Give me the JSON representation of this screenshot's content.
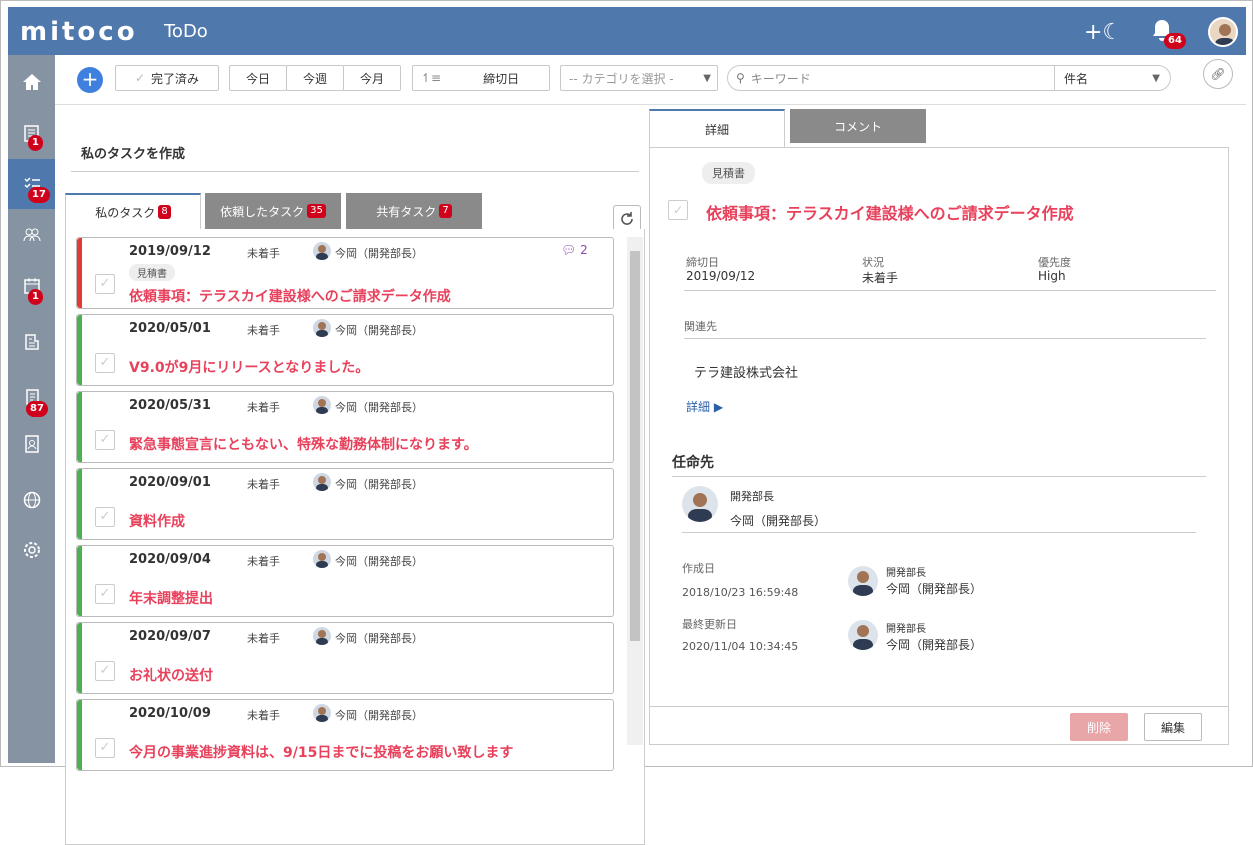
{
  "header": {
    "logo": "mitoco",
    "app_name": "ToDo",
    "quick_add": "+☾",
    "notifications_count": "64"
  },
  "nav": {
    "badges": {
      "doc": "1",
      "todo": "17",
      "calendar": "1",
      "workflow": "87"
    }
  },
  "toolbar": {
    "completed_label": "完了済み",
    "today": "今日",
    "this_week": "今週",
    "this_month": "今月",
    "sort_label": "締切日",
    "category_placeholder": "-- カテゴリを選択 -",
    "keyword_placeholder": "キーワード",
    "search_field": "件名"
  },
  "left": {
    "create_title": "私のタスクを作成",
    "tabs": [
      {
        "label": "私のタスク",
        "count": "8"
      },
      {
        "label": "依頼したタスク",
        "count": "35"
      },
      {
        "label": "共有タスク",
        "count": "7"
      }
    ],
    "tasks": [
      {
        "date": "2019/09/12",
        "status": "未着手",
        "owner": "今岡（開発部長）",
        "tag": "見積書",
        "title": "依頼事項：テラスカイ建設様へのご請求データ作成",
        "comments": "2",
        "color": "#e53935"
      },
      {
        "date": "2020/05/01",
        "status": "未着手",
        "owner": "今岡（開発部長）",
        "title": "V9.0が9月にリリースとなりました。",
        "color": "#4caf50"
      },
      {
        "date": "2020/05/31",
        "status": "未着手",
        "owner": "今岡（開発部長）",
        "title": "緊急事態宣言にともない、特殊な勤務体制になります。",
        "color": "#4caf50"
      },
      {
        "date": "2020/09/01",
        "status": "未着手",
        "owner": "今岡（開発部長）",
        "title": "資料作成",
        "color": "#4caf50"
      },
      {
        "date": "2020/09/04",
        "status": "未着手",
        "owner": "今岡（開発部長）",
        "title": "年末調整提出",
        "color": "#4caf50"
      },
      {
        "date": "2020/09/07",
        "status": "未着手",
        "owner": "今岡（開発部長）",
        "title": "お礼状の送付",
        "color": "#4caf50"
      },
      {
        "date": "2020/10/09",
        "status": "未着手",
        "owner": "今岡（開発部長）",
        "title": "今月の事業進捗資料は、9/15日までに投稿をお願い致します",
        "color": "#4caf50"
      }
    ]
  },
  "detail": {
    "tabs": {
      "detail": "詳細",
      "comment": "コメント"
    },
    "tag": "見積書",
    "title": "依頼事項：テラスカイ建設様へのご請求データ作成",
    "due_label": "締切日",
    "due": "2019/09/12",
    "status_label": "状況",
    "status": "未着手",
    "priority_label": "優先度",
    "priority": "High",
    "related_label": "関連先",
    "related": "テラ建設株式会社",
    "more_link": "詳細 ▶",
    "assignee_section": "任命先",
    "assignee_role": "開発部長",
    "assignee_name": "今岡（開発部長）",
    "created_label": "作成日",
    "created": "2018/10/23 16:59:48",
    "created_by_role": "開発部長",
    "created_by": "今岡（開発部長）",
    "updated_label": "最終更新日",
    "updated": "2020/11/04 10:34:45",
    "updated_by_role": "開発部長",
    "updated_by": "今岡（開発部長）",
    "delete_label": "削除",
    "edit_label": "編集"
  }
}
